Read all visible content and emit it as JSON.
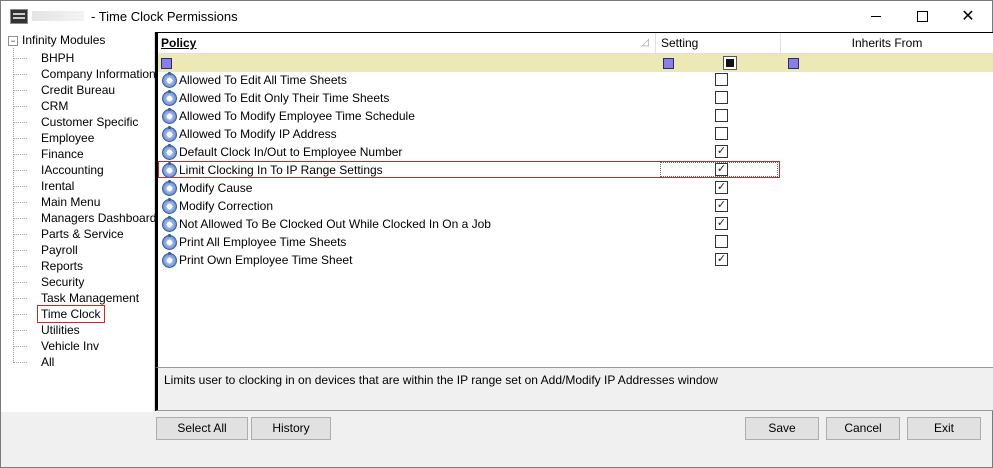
{
  "window": {
    "title": "- Time Clock Permissions",
    "min_icon": "minimize-icon",
    "max_icon": "maximize-icon",
    "close_glyph": "✕"
  },
  "tree": {
    "root_toggle": "−",
    "root_label": "Infinity Modules",
    "items": [
      "BHPH",
      "Company Information",
      "Credit Bureau",
      "CRM",
      "Customer Specific",
      "Employee",
      "Finance",
      "IAccounting",
      "Irental",
      "Main Menu",
      "Managers Dashboard",
      "Parts & Service",
      "Payroll",
      "Reports",
      "Security",
      "Task Management",
      "Time Clock",
      "Utilities",
      "Vehicle Inv",
      "All"
    ],
    "selected": "Time Clock"
  },
  "grid": {
    "columns": {
      "policy": "Policy",
      "setting": "Setting",
      "inherits": "Inherits From"
    },
    "sort_glyph": "◿",
    "rows": [
      {
        "label": "Allowed To Edit All Time Sheets",
        "checked": false
      },
      {
        "label": "Allowed To Edit Only Their Time Sheets",
        "checked": false
      },
      {
        "label": "Allowed To Modify Employee Time Schedule",
        "checked": false
      },
      {
        "label": "Allowed To Modify IP Address",
        "checked": false
      },
      {
        "label": "Default Clock In/Out to Employee Number",
        "checked": true
      },
      {
        "label": "Limit Clocking In To IP Range Settings",
        "checked": true,
        "highlighted": true
      },
      {
        "label": "Modify Cause",
        "checked": true
      },
      {
        "label": "Modify Correction",
        "checked": true
      },
      {
        "label": "Not Allowed To Be Clocked Out While Clocked In On a Job",
        "checked": true
      },
      {
        "label": "Print All Employee Time Sheets",
        "checked": false
      },
      {
        "label": "Print Own Employee Time Sheet",
        "checked": true
      }
    ],
    "check_glyph": "✓"
  },
  "description": "Limits user to clocking in on devices that are within the IP range set on Add/Modify IP Addresses window",
  "buttons": {
    "select_all": "Select All",
    "history": "History",
    "save": "Save",
    "cancel": "Cancel",
    "exit": "Exit"
  },
  "colors": {
    "filter_row": "#ece9b6",
    "highlight_border": "#c8262b"
  }
}
